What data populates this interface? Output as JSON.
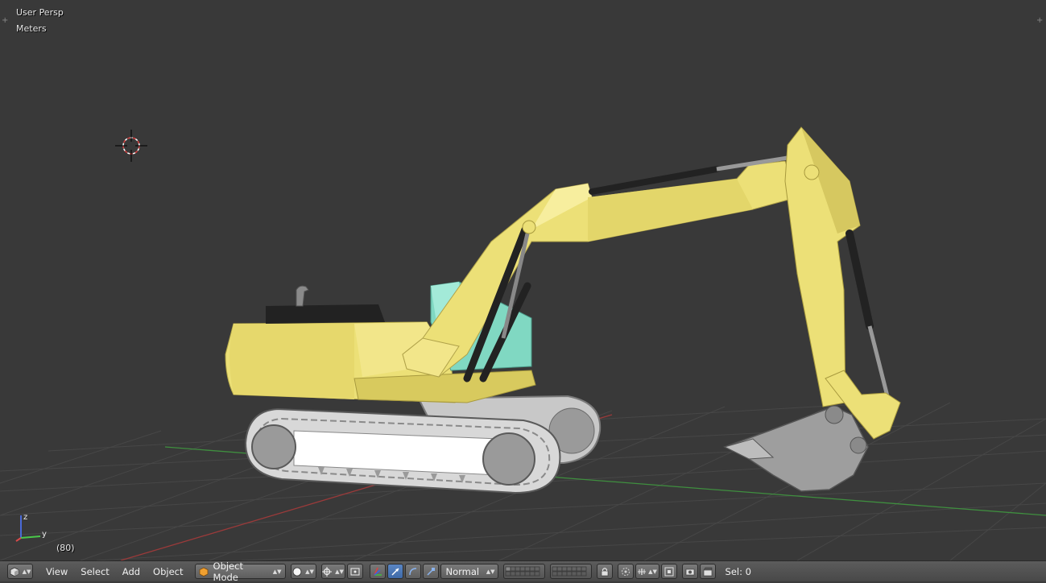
{
  "viewport": {
    "view_name": "User Persp",
    "units": "Meters",
    "frame": "(80)",
    "axes": {
      "z": "z",
      "y": "y"
    }
  },
  "header": {
    "menus": [
      "View",
      "Select",
      "Add",
      "Object"
    ],
    "mode": "Object Mode",
    "transform_orientation": "Normal",
    "selection": "Sel: 0"
  },
  "colors": {
    "viewport_bg": "#393939",
    "grid_line": "#4a4a4a",
    "x_axis": "#a53a3a",
    "y_axis": "#3f8f3f",
    "excavator_body": "#ecdf7a",
    "cab_glass": "#7fd6c0",
    "header_bg": "#545454",
    "active_button": "#4f7cbb"
  }
}
